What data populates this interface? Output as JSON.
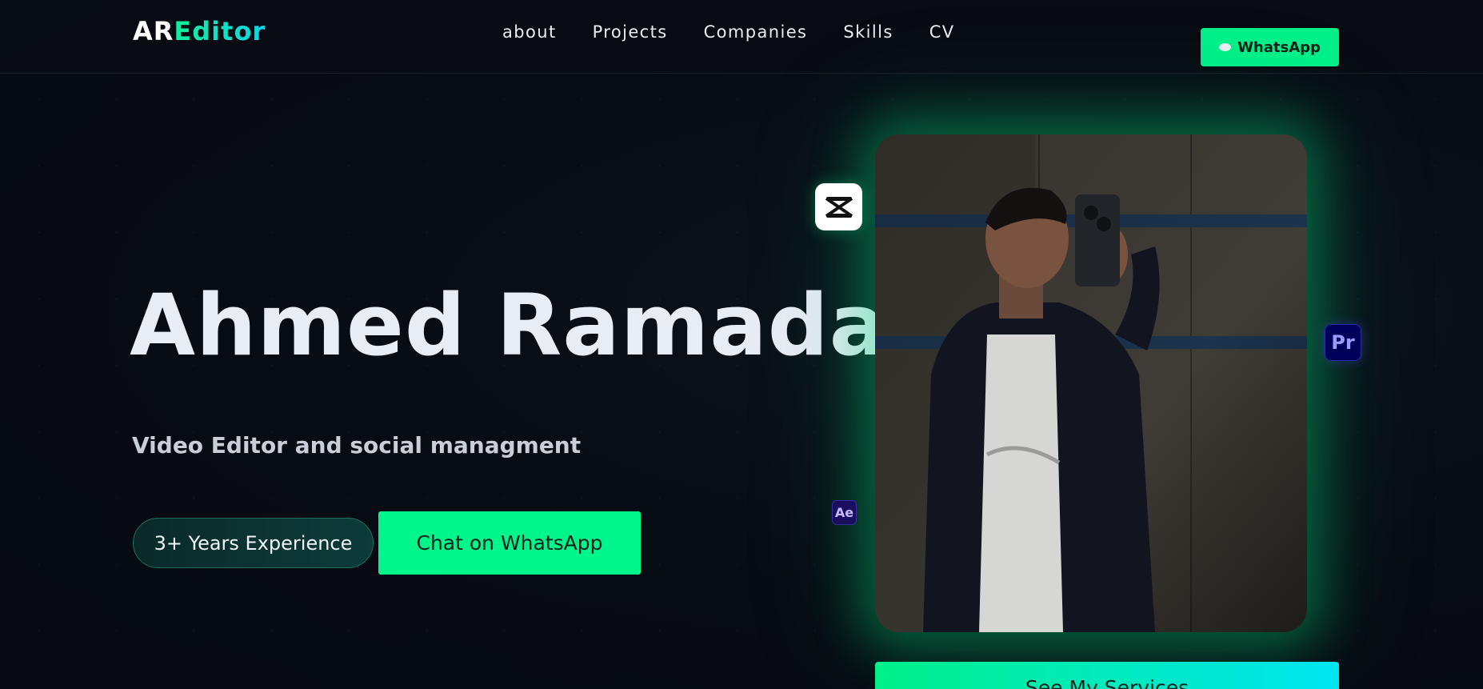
{
  "header": {
    "logo_part1": "AR",
    "logo_part2": "Editor",
    "nav": [
      "about",
      "Projects",
      "Companies",
      "Skills",
      "CV"
    ],
    "whatsapp_label": "WhatsApp"
  },
  "hero": {
    "name": "Ahmed Ramadan",
    "subtitle": "Video Editor and social managment",
    "experience_badge": "3+ Years Experience",
    "cta_label": "Chat on WhatsApp",
    "services_label": "See My Services"
  },
  "tool_badges": {
    "capcut_icon": "capcut-icon",
    "premiere_label": "Pr",
    "after_effects_label": "Ae"
  },
  "colors": {
    "accent": "#00f58b",
    "accent_cyan": "#00e4f0",
    "background": "#070b12"
  }
}
